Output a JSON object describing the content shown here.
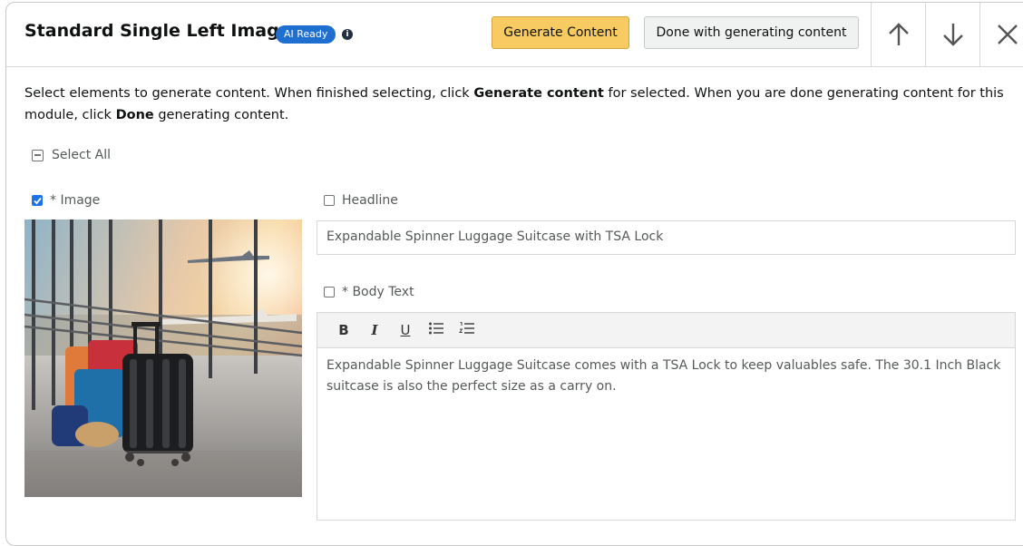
{
  "header": {
    "title": "Standard Single Left Image",
    "badge": "AI Ready",
    "info_icon": "i",
    "generate_button": "Generate Content",
    "done_button": "Done with generating content",
    "icons": [
      "arrow-up-icon",
      "arrow-down-icon",
      "close-icon"
    ]
  },
  "instructions": {
    "part1": "Select elements to generate content. When finished selecting, click ",
    "bold1": "Generate content",
    "part2": " for selected. When you are done generating content for this module, click ",
    "bold2": "Done",
    "part3": " generating content."
  },
  "select_all": {
    "label": "Select All"
  },
  "image_section": {
    "label": "* Image",
    "checked": true
  },
  "headline": {
    "label": "Headline",
    "checked": false,
    "value": "Expandable Spinner Luggage Suitcase with TSA Lock"
  },
  "body_text": {
    "label": "* Body Text",
    "checked": false,
    "toolbar": {
      "bold": "B",
      "italic": "I",
      "underline": "U"
    },
    "value": "Expandable Spinner Luggage Suitcase comes with a TSA Lock to keep valuables safe. The 30.1 Inch Black suitcase is also the perfect size as a carry on."
  },
  "colors": {
    "generate_button": "#f7ca62",
    "badge": "#1f6fd1",
    "checkbox": "#1a73e8"
  }
}
